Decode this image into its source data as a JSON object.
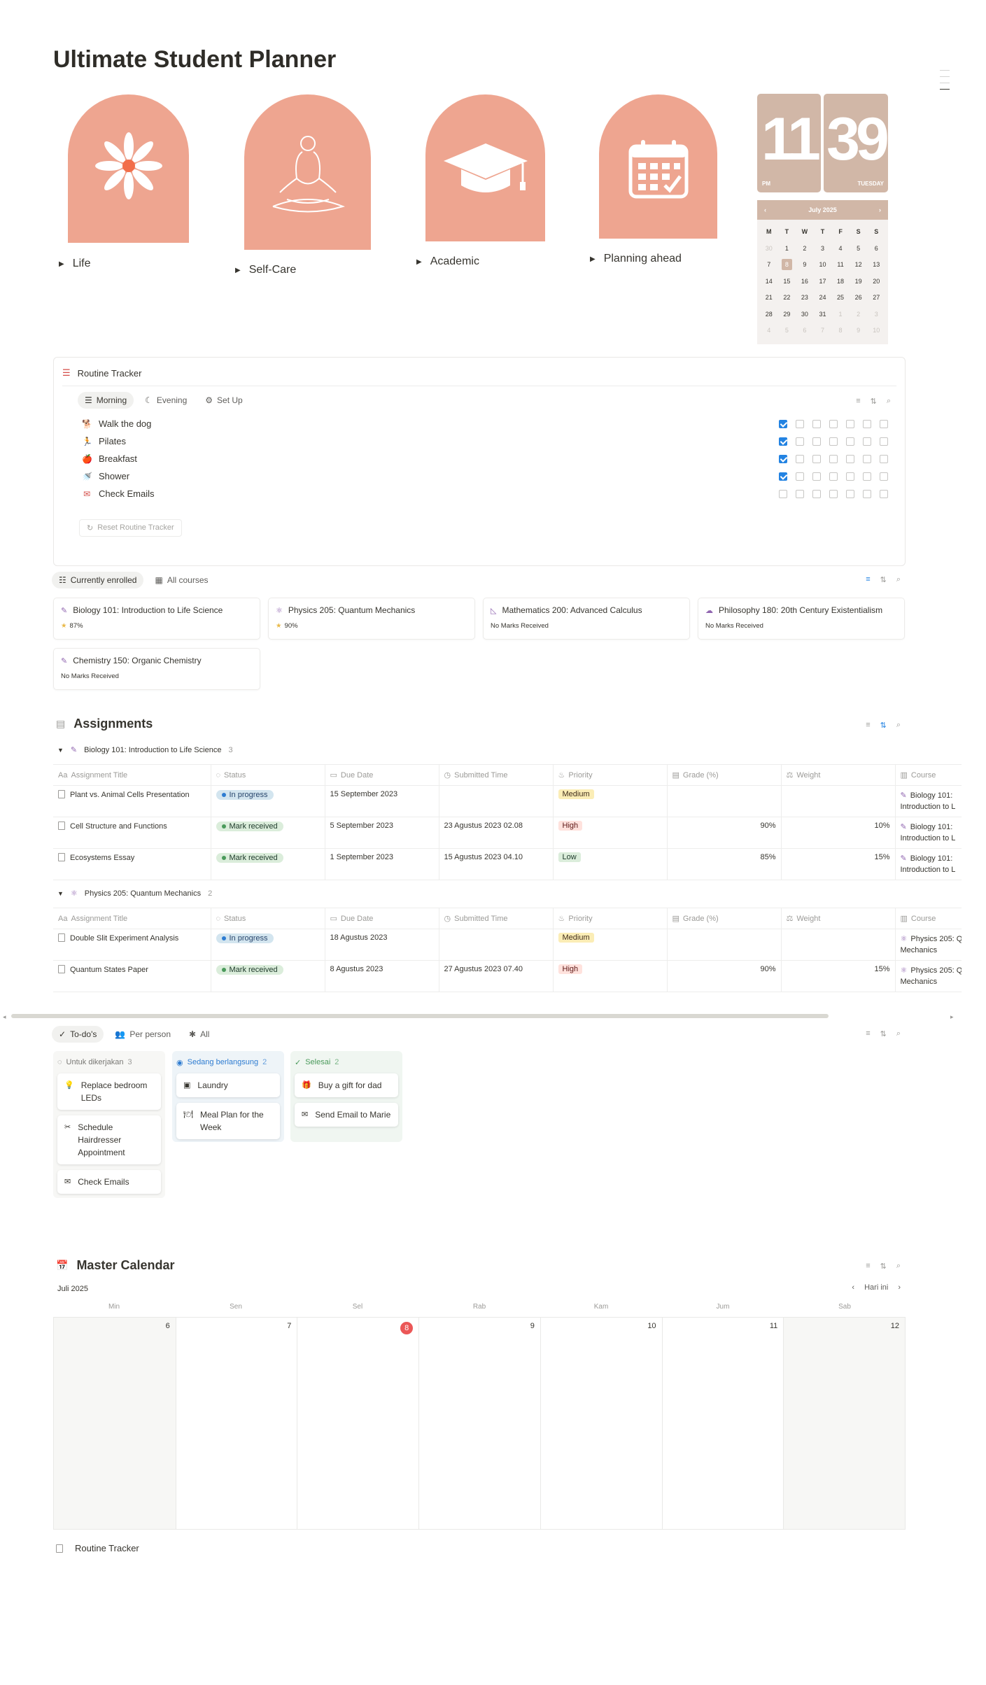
{
  "page": {
    "title": "Ultimate Student Planner"
  },
  "sections": [
    {
      "label": "Life",
      "icon": "daisy-icon"
    },
    {
      "label": "Self-Care",
      "icon": "meditation-icon"
    },
    {
      "label": "Academic",
      "icon": "graduation-cap-icon"
    },
    {
      "label": "Planning ahead",
      "icon": "calendar-icon"
    }
  ],
  "clock": {
    "hour": "11",
    "minute": "39",
    "ampm": "PM",
    "day": "TUESDAY"
  },
  "mini_calendar": {
    "month": "July 2025",
    "prev": "‹",
    "next": "›",
    "weekdays": [
      "M",
      "T",
      "W",
      "T",
      "F",
      "S",
      "S"
    ],
    "weeks": [
      [
        "30",
        "1",
        "2",
        "3",
        "4",
        "5",
        "6"
      ],
      [
        "7",
        "8",
        "9",
        "10",
        "11",
        "12",
        "13"
      ],
      [
        "14",
        "15",
        "16",
        "17",
        "18",
        "19",
        "20"
      ],
      [
        "21",
        "22",
        "23",
        "24",
        "25",
        "26",
        "27"
      ],
      [
        "28",
        "29",
        "30",
        "31",
        "1",
        "2",
        "3"
      ],
      [
        "4",
        "5",
        "6",
        "7",
        "8",
        "9",
        "10"
      ]
    ],
    "today": "8"
  },
  "routine": {
    "title": "Routine Tracker",
    "tabs": [
      "Morning",
      "Evening",
      "Set Up"
    ],
    "items": [
      {
        "label": "Walk the dog",
        "icon": "dog-icon",
        "checks": [
          true,
          false,
          false,
          false,
          false,
          false,
          false
        ]
      },
      {
        "label": "Pilates",
        "icon": "running-icon",
        "checks": [
          true,
          false,
          false,
          false,
          false,
          false,
          false
        ]
      },
      {
        "label": "Breakfast",
        "icon": "apple-icon",
        "checks": [
          true,
          false,
          false,
          false,
          false,
          false,
          false
        ]
      },
      {
        "label": "Shower",
        "icon": "shower-icon",
        "checks": [
          true,
          false,
          false,
          false,
          false,
          false,
          false
        ]
      },
      {
        "label": "Check Emails",
        "icon": "mail-icon",
        "checks": [
          false,
          false,
          false,
          false,
          false,
          false,
          false
        ]
      }
    ],
    "reset_label": "Reset Routine Tracker"
  },
  "courses": {
    "tabs": [
      "Currently enrolled",
      "All courses"
    ],
    "cards": [
      {
        "title": "Biology 101: Introduction to Life Science",
        "status": "87%",
        "icon": "pipette-icon",
        "status_icon": "star-icon"
      },
      {
        "title": "Physics 205: Quantum Mechanics",
        "status": "90%",
        "icon": "atom-icon",
        "status_icon": "star-icon"
      },
      {
        "title": "Mathematics 200: Advanced Calculus",
        "status": "No Marks Received",
        "icon": "ruler-icon"
      },
      {
        "title": "Philosophy 180: 20th Century Existentialism",
        "status": "No Marks Received",
        "icon": "thought-icon"
      },
      {
        "title": "Chemistry 150: Organic Chemistry",
        "status": "No Marks Received",
        "icon": "test-tube-icon"
      }
    ]
  },
  "assignments": {
    "title": "Assignments",
    "columns": [
      "Assignment Title",
      "Status",
      "Due Date",
      "Submitted Time",
      "Priority",
      "Grade (%)",
      "Weight",
      "Course"
    ],
    "groups": [
      {
        "name": "Biology 101: Introduction to Life Science",
        "count": "3",
        "rows": [
          {
            "title": "Plant vs. Animal Cells Presentation",
            "status": "In progress",
            "due": "15 September 2023",
            "submitted": "",
            "priority": "Medium",
            "grade": "",
            "weight": "",
            "course1": "Biology 101: ",
            "course2": "Introduction to L"
          },
          {
            "title": "Cell Structure and Functions",
            "status": "Mark received",
            "due": "5 September 2023",
            "submitted": "23 Agustus 2023 02.08",
            "priority": "High",
            "grade": "90%",
            "weight": "10%",
            "course1": "Biology 101: ",
            "course2": "Introduction to L"
          },
          {
            "title": "Ecosystems Essay",
            "status": "Mark received",
            "due": "1 September 2023",
            "submitted": "15 Agustus 2023 04.10",
            "priority": "Low",
            "grade": "85%",
            "weight": "15%",
            "course1": "Biology 101: ",
            "course2": "Introduction to L"
          }
        ]
      },
      {
        "name": "Physics 205: Quantum Mechanics",
        "count": "2",
        "rows": [
          {
            "title": "Double Slit Experiment Analysis",
            "status": "In progress",
            "due": "18 Agustus 2023",
            "submitted": "",
            "priority": "Medium",
            "grade": "",
            "weight": "",
            "course1": "Physics 205: Q",
            "course2": "Mechanics"
          },
          {
            "title": "Quantum States Paper",
            "status": "Mark received",
            "due": "8 Agustus 2023",
            "submitted": "27 Agustus 2023 07.40",
            "priority": "High",
            "grade": "90%",
            "weight": "15%",
            "course1": "Physics 205: Q",
            "course2": "Mechanics"
          }
        ]
      }
    ]
  },
  "todos": {
    "tabs": [
      "To-do's",
      "Per person",
      "All"
    ],
    "columns": [
      {
        "name": "Untuk dikerjakan",
        "count": "3",
        "cards": [
          {
            "label": "Replace bedroom LEDs",
            "icon": "bulb-icon"
          },
          {
            "label": "Schedule Hairdresser Appointment",
            "icon": "hairdryer-icon"
          },
          {
            "label": "Check Emails",
            "icon": "mail-icon"
          }
        ]
      },
      {
        "name": "Sedang berlangsung",
        "count": "2",
        "cards": [
          {
            "label": "Laundry",
            "icon": "washer-icon"
          },
          {
            "label": "Meal Plan for the Week",
            "icon": "meal-icon"
          }
        ]
      },
      {
        "name": "Selesai",
        "count": "2",
        "cards": [
          {
            "label": "Buy a gift for dad",
            "icon": "gift-icon"
          },
          {
            "label": "Send Email to Marie",
            "icon": "mail-icon"
          }
        ]
      }
    ]
  },
  "master_calendar": {
    "title": "Master Calendar",
    "month": "Juli 2025",
    "today_label": "Hari ini",
    "weekdays": [
      "Min",
      "Sen",
      "Sel",
      "Rab",
      "Kam",
      "Jum",
      "Sab"
    ],
    "days": [
      "6",
      "7",
      "8",
      "9",
      "10",
      "11",
      "12"
    ],
    "today": "8"
  },
  "footer_link": "Routine Tracker",
  "colors": {
    "accent": "#eea590",
    "clock": "#d1b7a7",
    "blue": "#2383e2"
  }
}
